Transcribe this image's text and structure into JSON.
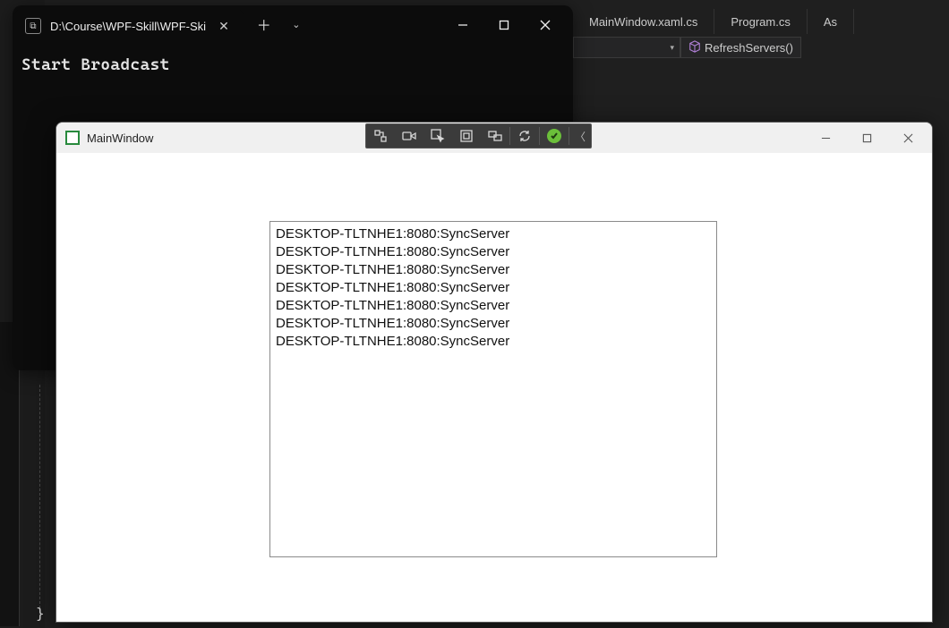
{
  "vs": {
    "tabs": [
      "MainWindow.xaml.cs",
      "Program.cs",
      "As"
    ],
    "method": "RefreshServers()"
  },
  "console": {
    "tab_title": "D:\\Course\\WPF-Skill\\WPF-Ski",
    "output": "Start Broadcast"
  },
  "app": {
    "title": "MainWindow",
    "list": [
      "DESKTOP-TLTNHE1:8080:SyncServer",
      "DESKTOP-TLTNHE1:8080:SyncServer",
      "DESKTOP-TLTNHE1:8080:SyncServer",
      "DESKTOP-TLTNHE1:8080:SyncServer",
      "DESKTOP-TLTNHE1:8080:SyncServer",
      "DESKTOP-TLTNHE1:8080:SyncServer",
      "DESKTOP-TLTNHE1:8080:SyncServer"
    ]
  },
  "brace": "}"
}
